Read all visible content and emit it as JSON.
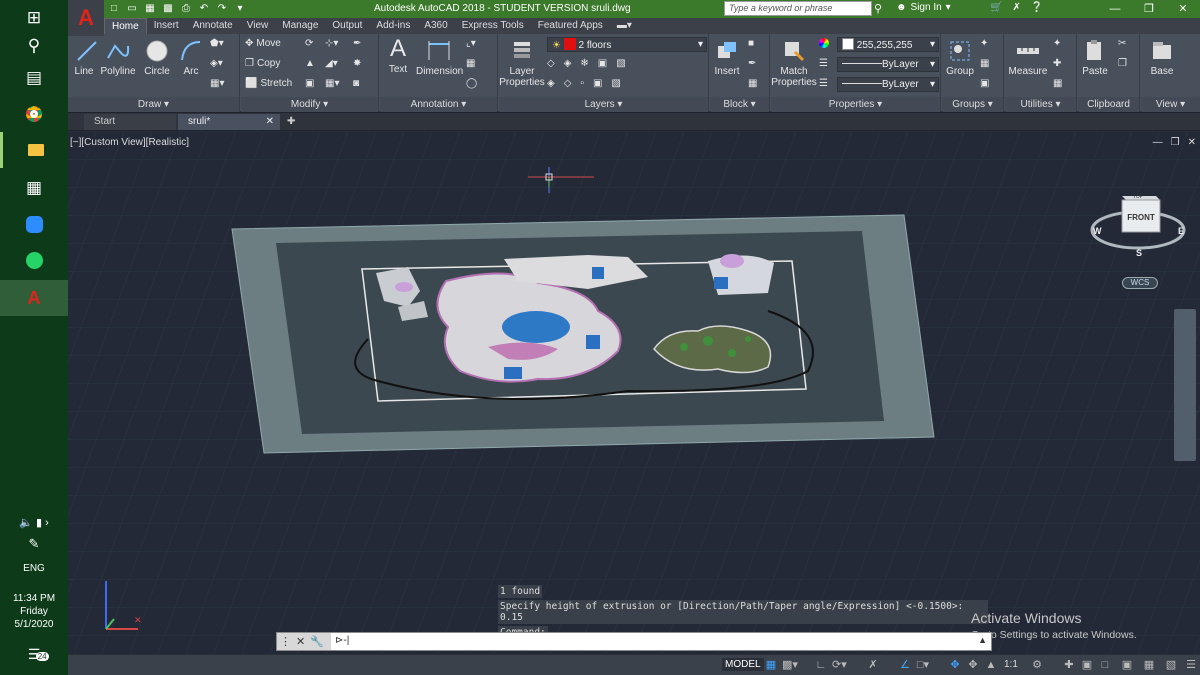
{
  "taskbar": {
    "clock_time": "11:34 PM",
    "clock_day": "Friday",
    "clock_date": "5/1/2020",
    "language": "ENG",
    "notification_count": "24"
  },
  "titlebar": {
    "title": "Autodesk AutoCAD 2018 - STUDENT VERSION    sruli.dwg",
    "search_placeholder": "Type a keyword or phrase",
    "sign_in": "Sign In"
  },
  "ribbon_tabs": [
    "Home",
    "Insert",
    "Annotate",
    "View",
    "Manage",
    "Output",
    "Add-ins",
    "A360",
    "Express Tools",
    "Featured Apps"
  ],
  "ribbon": {
    "draw": {
      "title": "Draw",
      "line": "Line",
      "polyline": "Polyline",
      "circle": "Circle",
      "arc": "Arc"
    },
    "modify": {
      "title": "Modify",
      "move": "Move",
      "copy": "Copy",
      "stretch": "Stretch"
    },
    "annotation": {
      "title": "Annotation",
      "text": "Text",
      "dimension": "Dimension"
    },
    "layers": {
      "title": "Layers",
      "layer_properties_1": "Layer",
      "layer_properties_2": "Properties",
      "current_layer": "2 floors"
    },
    "block": {
      "title": "Block",
      "insert": "Insert"
    },
    "properties": {
      "title": "Properties",
      "match_1": "Match",
      "match_2": "Properties",
      "color": "255,255,255",
      "linetype": "ByLayer",
      "lineweight": "ByLayer"
    },
    "groups": {
      "title": "Groups",
      "group": "Group"
    },
    "utilities": {
      "title": "Utilities",
      "measure": "Measure"
    },
    "clipboard": {
      "title": "Clipboard",
      "paste": "Paste"
    },
    "view": {
      "title": "View",
      "base": "Base"
    }
  },
  "doc_tabs": {
    "start": "Start",
    "file": "sruli*"
  },
  "viewport": {
    "label": "[−][Custom View][Realistic]",
    "viewcube_top": "TOP",
    "viewcube_front": "FRONT",
    "compass_w": "W",
    "compass_e": "E",
    "compass_s": "S",
    "wcs": "WCS"
  },
  "command_history": [
    "1 found",
    "Specify height of extrusion or [Direction/Path/Taper angle/Expression] <-0.1500>: 0.15",
    "Command:"
  ],
  "watermark": {
    "line1": "Activate Windows",
    "line2": "Go to Settings to activate Windows."
  },
  "status": {
    "model": "MODEL",
    "scale": "1:1"
  },
  "colors": {
    "accent_green": "#3c7a2b",
    "autocad_red": "#e0241b",
    "taskbar": "#0d3b1a"
  }
}
